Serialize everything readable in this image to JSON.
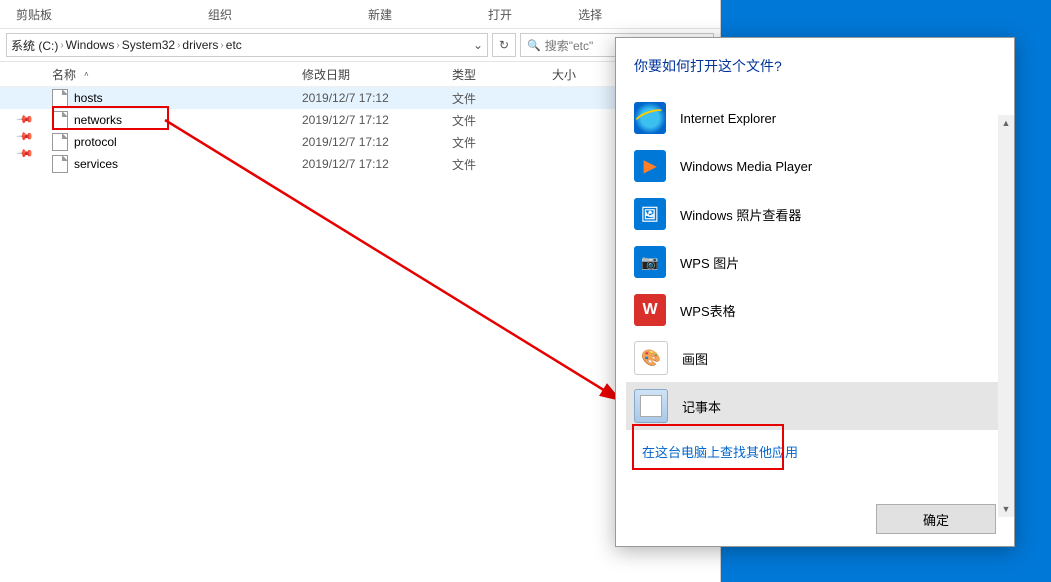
{
  "ribbon": {
    "clipboard": "剪贴板",
    "organize": "组织",
    "new": "新建",
    "open": "打开",
    "select": "选择"
  },
  "breadcrumb": {
    "drive": "系统 (C:)",
    "p1": "Windows",
    "p2": "System32",
    "p3": "drivers",
    "p4": "etc"
  },
  "search": {
    "placeholder": "搜索\"etc\""
  },
  "columns": {
    "name": "名称",
    "date": "修改日期",
    "type": "类型",
    "size": "大小"
  },
  "files": [
    {
      "name": "hosts",
      "date": "2019/12/7 17:12",
      "type": "文件",
      "selected": true
    },
    {
      "name": "networks",
      "date": "2019/12/7 17:12",
      "type": "文件",
      "selected": false
    },
    {
      "name": "protocol",
      "date": "2019/12/7 17:12",
      "type": "文件",
      "selected": false
    },
    {
      "name": "services",
      "date": "2019/12/7 17:12",
      "type": "文件",
      "selected": false
    }
  ],
  "dialog": {
    "title": "你要如何打开这个文件?",
    "apps": [
      {
        "name": "Internet Explorer",
        "icon": "ie"
      },
      {
        "name": "Windows Media Player",
        "icon": "wmp"
      },
      {
        "name": "Windows 照片查看器",
        "icon": "photo"
      },
      {
        "name": "WPS 图片",
        "icon": "wpsimg"
      },
      {
        "name": "WPS表格",
        "icon": "wpssheet"
      },
      {
        "name": "画图",
        "icon": "paint"
      },
      {
        "name": "记事本",
        "icon": "notepad",
        "selected": true
      }
    ],
    "more": "在这台电脑上查找其他应用",
    "ok": "确定"
  }
}
